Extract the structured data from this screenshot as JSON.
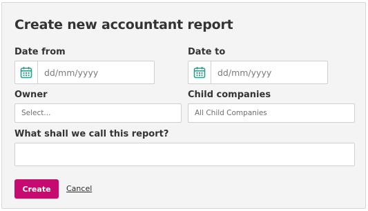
{
  "dialog": {
    "title": "Create new accountant report"
  },
  "form": {
    "date_from": {
      "label": "Date from",
      "placeholder": "dd/mm/yyyy",
      "icon": "calendar-icon"
    },
    "date_to": {
      "label": "Date to",
      "placeholder": "dd/mm/yyyy",
      "icon": "calendar-icon"
    },
    "owner": {
      "label": "Owner",
      "value": "Select..."
    },
    "child_companies": {
      "label": "Child companies",
      "value": "All Child Companies"
    },
    "report_name": {
      "label": "What shall we call this report?",
      "value": ""
    }
  },
  "actions": {
    "create_label": "Create",
    "cancel_label": "Cancel"
  },
  "colors": {
    "accent": "#c70a6f",
    "calendar_icon": "#2a9d8f",
    "panel_bg": "#f4f4f4"
  }
}
